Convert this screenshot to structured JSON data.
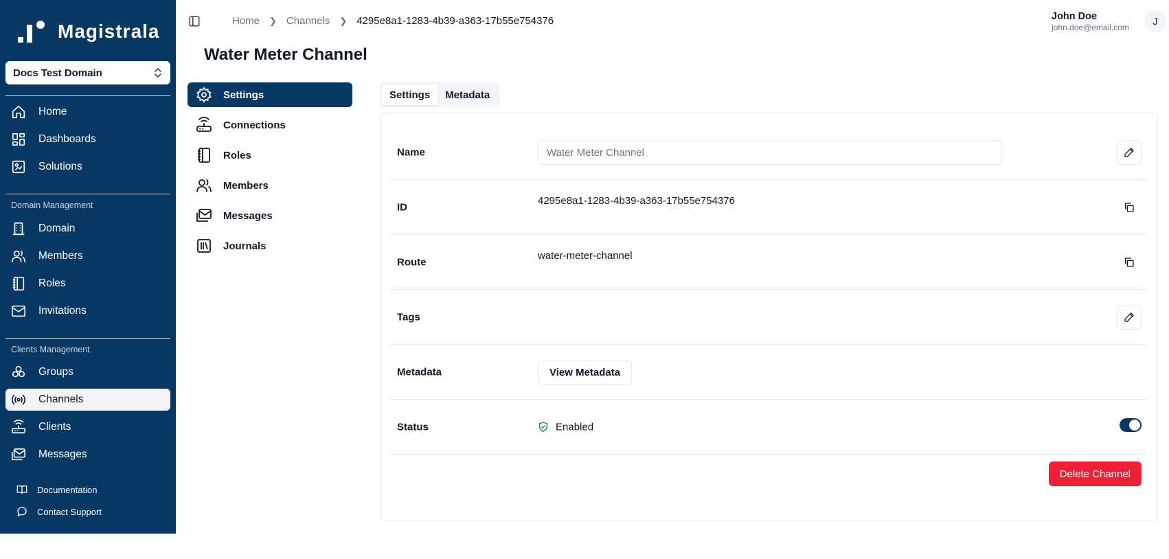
{
  "brand": {
    "name": "Magistrala",
    "primary_color": "#073763",
    "danger_color": "#ef1f35"
  },
  "domain_selector": {
    "value": "Docs Test Domain"
  },
  "sidebar": {
    "main_items": [
      {
        "label": "Home",
        "icon": "home-icon"
      },
      {
        "label": "Dashboards",
        "icon": "dashboard-icon"
      },
      {
        "label": "Solutions",
        "icon": "solutions-icon"
      }
    ],
    "domain_section": {
      "title": "Domain Management",
      "items": [
        {
          "label": "Domain",
          "icon": "building-icon"
        },
        {
          "label": "Members",
          "icon": "users-icon"
        },
        {
          "label": "Roles",
          "icon": "notebook-icon"
        },
        {
          "label": "Invitations",
          "icon": "mail-icon"
        }
      ]
    },
    "clients_section": {
      "title": "Clients Management",
      "items": [
        {
          "label": "Groups",
          "icon": "groups-icon"
        },
        {
          "label": "Channels",
          "icon": "radio-icon",
          "active": true
        },
        {
          "label": "Clients",
          "icon": "router-icon"
        },
        {
          "label": "Messages",
          "icon": "messages-icon"
        }
      ]
    },
    "footer": [
      {
        "label": "Documentation",
        "icon": "book-icon"
      },
      {
        "label": "Contact Support",
        "icon": "chat-icon"
      }
    ]
  },
  "breadcrumb": [
    "Home",
    "Channels",
    "4295e8a1-1283-4b39-a363-17b55e754376"
  ],
  "user": {
    "name": "John Doe",
    "email": "john.doe@email.com",
    "initial": "J"
  },
  "page": {
    "title": "Water Meter Channel"
  },
  "subnav": [
    {
      "label": "Settings",
      "icon": "gear-icon",
      "active": true
    },
    {
      "label": "Connections",
      "icon": "router-icon"
    },
    {
      "label": "Roles",
      "icon": "notebook-icon"
    },
    {
      "label": "Members",
      "icon": "users-icon"
    },
    {
      "label": "Messages",
      "icon": "messages-icon"
    },
    {
      "label": "Journals",
      "icon": "library-icon"
    }
  ],
  "tabs": [
    {
      "label": "Settings",
      "active": true
    },
    {
      "label": "Metadata"
    }
  ],
  "settings": {
    "name": {
      "label": "Name",
      "placeholder": "Water Meter Channel"
    },
    "id": {
      "label": "ID",
      "value": "4295e8a1-1283-4b39-a363-17b55e754376"
    },
    "route": {
      "label": "Route",
      "value": "water-meter-channel"
    },
    "tags": {
      "label": "Tags"
    },
    "metadata": {
      "label": "Metadata",
      "button": "View Metadata"
    },
    "status": {
      "label": "Status",
      "value": "Enabled",
      "enabled": true
    },
    "delete_button": "Delete Channel"
  }
}
